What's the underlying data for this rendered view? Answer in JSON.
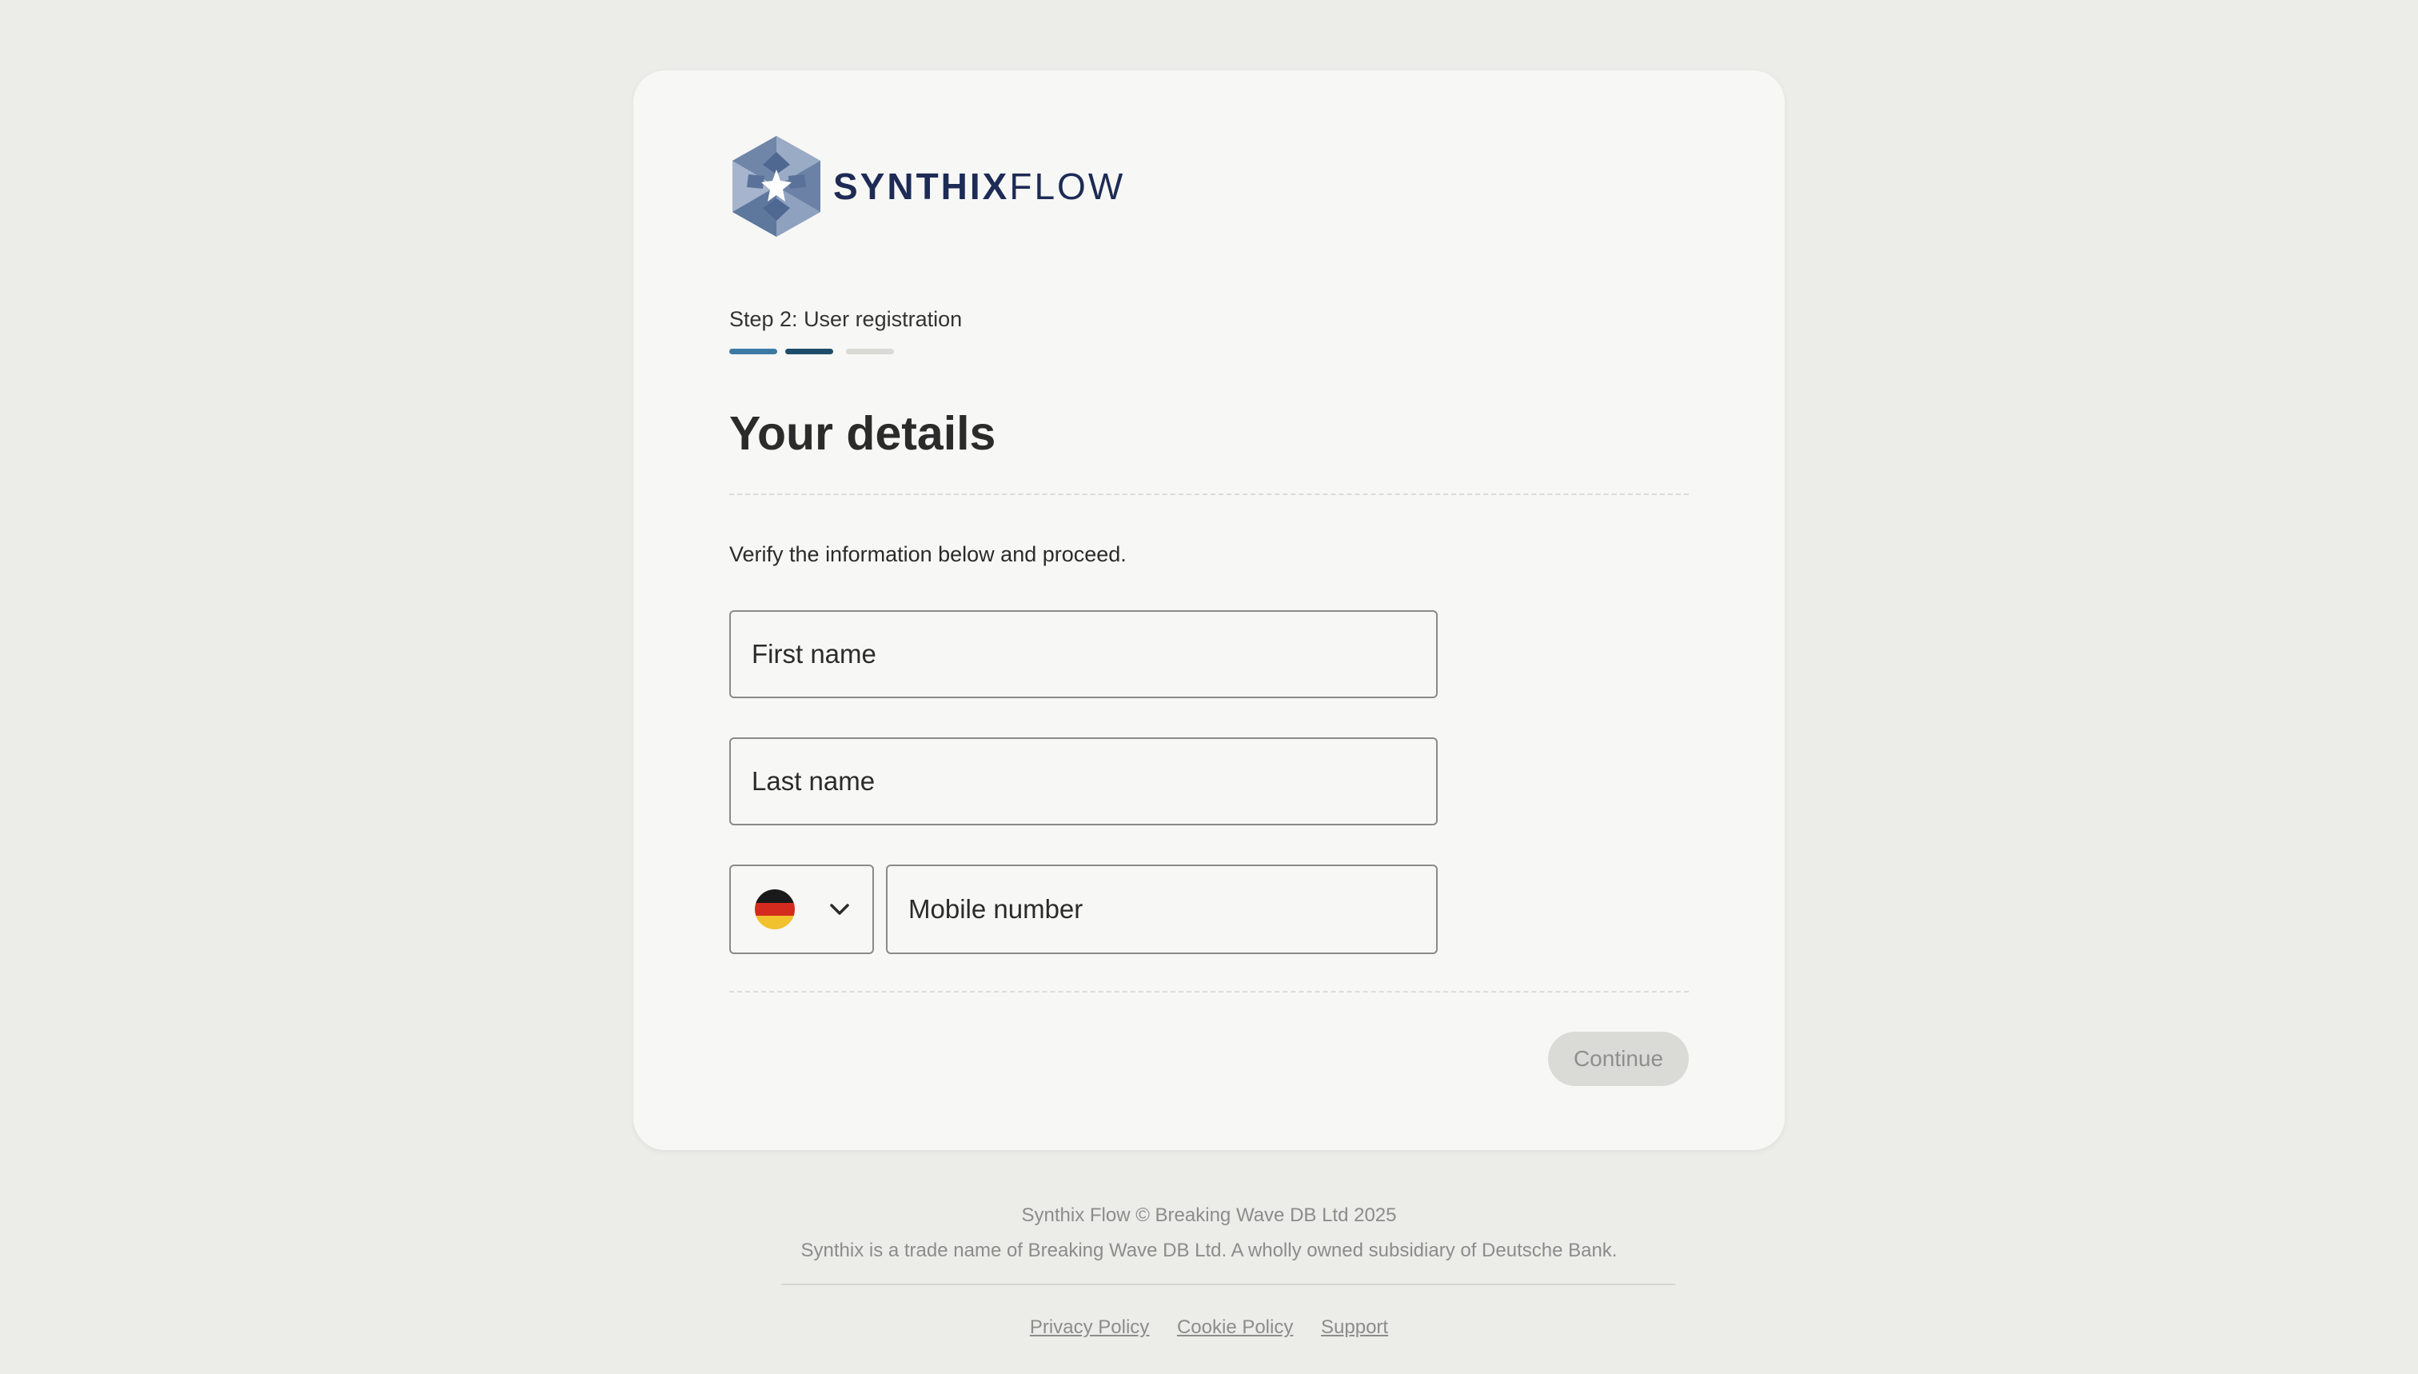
{
  "brand": {
    "name_bold": "SYNTHIX",
    "name_light": "FLOW",
    "primary_color": "#1d2b55"
  },
  "step": {
    "label": "Step 2: User registration",
    "current": 2,
    "total": 3
  },
  "form": {
    "heading": "Your details",
    "description": "Verify the information below and proceed.",
    "first_name_placeholder": "First name",
    "last_name_placeholder": "Last name",
    "mobile_placeholder": "Mobile number",
    "country_flag": "germany-flag-icon",
    "continue_label": "Continue"
  },
  "footer": {
    "copyright": "Synthix Flow © Breaking Wave DB Ltd 2025",
    "legal": "Synthix is a trade name of Breaking Wave DB Ltd. A wholly owned subsidiary of Deutsche Bank.",
    "links": [
      "Privacy Policy",
      "Cookie Policy",
      "Support"
    ]
  },
  "colors": {
    "background": "#ecece8",
    "card": "#f7f7f5",
    "progress_done": "#3c7aa6",
    "progress_current": "#1e4d6a",
    "progress_todo": "#d9d9d6",
    "button_disabled": "#dadad7"
  }
}
